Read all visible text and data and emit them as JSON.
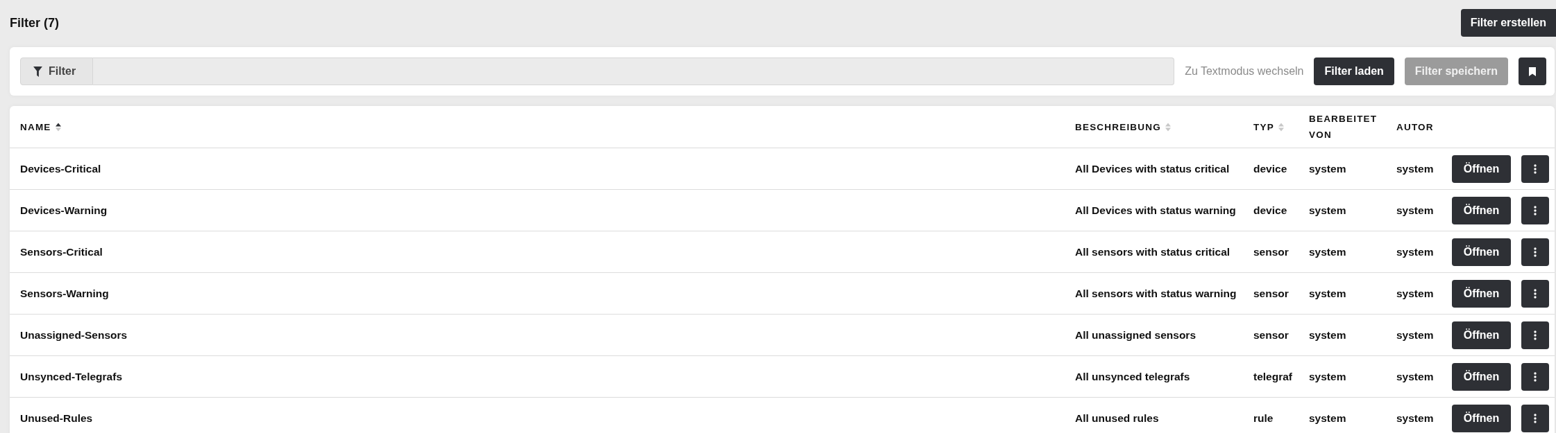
{
  "page": {
    "title": "Filter (7)",
    "create_button": "Filter erstellen"
  },
  "filter_bar": {
    "addon": "Filter",
    "text_mode_link": "Zu Textmodus wechseln",
    "buttons": [
      {
        "label": "Filter laden",
        "disabled": false
      },
      {
        "label": "Filter speichern",
        "disabled": true
      }
    ]
  },
  "table": {
    "columns": [
      {
        "label": "NAME",
        "sortable": true,
        "sorted": true
      },
      {
        "label": "BESCHREIBUNG",
        "sortable": true,
        "sorted": false
      },
      {
        "label": "TYP",
        "sortable": true,
        "sorted": false
      },
      {
        "label": "BEARBEITET VON",
        "sortable": false
      },
      {
        "label": "AUTOR",
        "sortable": false
      }
    ],
    "rows": [
      {
        "name": "Devices-Critical",
        "description": "All Devices with status critical",
        "type": "device",
        "edited_by": "system",
        "author": "system",
        "open_button": "Öffnen"
      },
      {
        "name": "Devices-Warning",
        "description": "All Devices with status warning",
        "type": "device",
        "edited_by": "system",
        "author": "system",
        "open_button": "Öffnen"
      },
      {
        "name": "Sensors-Critical",
        "description": "All sensors with status critical",
        "type": "sensor",
        "edited_by": "system",
        "author": "system",
        "open_button": "Öffnen"
      },
      {
        "name": "Sensors-Warning",
        "description": "All sensors with status warning",
        "type": "sensor",
        "edited_by": "system",
        "author": "system",
        "open_button": "Öffnen"
      },
      {
        "name": "Unassigned-Sensors",
        "description": "All unassigned sensors",
        "type": "sensor",
        "edited_by": "system",
        "author": "system",
        "open_button": "Öffnen"
      },
      {
        "name": "Unsynced-Telegrafs",
        "description": "All unsynced telegrafs",
        "type": "telegraf",
        "edited_by": "system",
        "author": "system",
        "open_button": "Öffnen"
      },
      {
        "name": "Unused-Rules",
        "description": "All unused rules",
        "type": "rule",
        "edited_by": "system",
        "author": "system",
        "open_button": "Öffnen"
      }
    ]
  }
}
